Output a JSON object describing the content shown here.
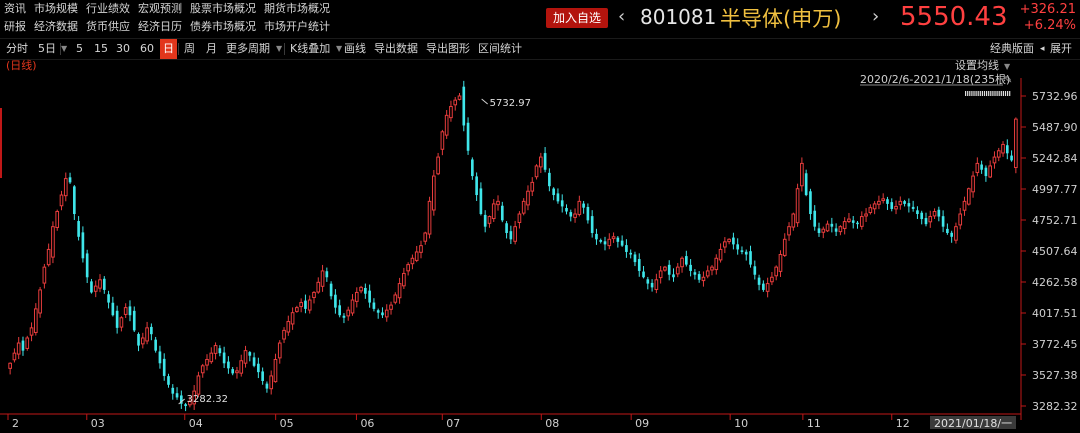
{
  "nav": {
    "row1": [
      "资讯",
      "市场规模",
      "行业绩效",
      "宏观预测",
      "股票市场概况",
      "期货市场概况"
    ],
    "row2": [
      "研报",
      "经济数据",
      "货币供应",
      "经济日历",
      "债券市场概况",
      "市场开户统计"
    ]
  },
  "quote": {
    "add_favorite": "加入自选",
    "prev_arrow": "‹",
    "next_arrow": "›",
    "code": "801081",
    "name": "半导体(申万)",
    "price": "5550.43",
    "change": "+326.21",
    "change_pct": "+6.24%"
  },
  "toolbar": {
    "items": [
      "分时",
      "5日",
      "5",
      "15",
      "30",
      "60",
      "日",
      "周",
      "月",
      "更多周期",
      "K线叠加",
      "画线",
      "导出数据",
      "导出图形",
      "区间统计"
    ],
    "active": "日",
    "right_items": [
      "经典版面",
      "展开"
    ]
  },
  "chart_overlay": {
    "daily_label": "(日线)",
    "ma_setting": "设置均线",
    "range_text": "2020/2/6-2021/1/18(235根)",
    "cursor_date": "2021/01/18/一"
  },
  "chart_data": {
    "type": "candlestick",
    "title": "",
    "period": "日线",
    "ylim": [
      3200,
      5800
    ],
    "y_ticks": [
      "5732.96",
      "5487.90",
      "5242.84",
      "4997.77",
      "4752.71",
      "4507.64",
      "4262.58",
      "4017.51",
      "3772.45",
      "3527.38",
      "3282.32"
    ],
    "x_ticks": [
      {
        "label": "2",
        "t": 0.0
      },
      {
        "label": "03",
        "t": 0.078
      },
      {
        "label": "04",
        "t": 0.175
      },
      {
        "label": "05",
        "t": 0.265
      },
      {
        "label": "06",
        "t": 0.345
      },
      {
        "label": "07",
        "t": 0.43
      },
      {
        "label": "08",
        "t": 0.528
      },
      {
        "label": "09",
        "t": 0.617
      },
      {
        "label": "10",
        "t": 0.715
      },
      {
        "label": "11",
        "t": 0.787
      },
      {
        "label": "12",
        "t": 0.875
      }
    ],
    "annotations": [
      {
        "label": "5732.97",
        "type": "high",
        "t": 0.465,
        "value": 5732.97
      },
      {
        "label": "3282.32",
        "type": "low",
        "t": 0.165,
        "value": 3282.32
      }
    ],
    "closes": [
      3620,
      3700,
      3780,
      3720,
      3820,
      3900,
      4050,
      4200,
      4380,
      4520,
      4700,
      4820,
      4950,
      5080,
      5050,
      4800,
      4620,
      4450,
      4300,
      4180,
      4230,
      4280,
      4200,
      4100,
      4000,
      3900,
      3980,
      4060,
      4000,
      3880,
      3760,
      3820,
      3900,
      3850,
      3720,
      3620,
      3520,
      3450,
      3380,
      3350,
      3300,
      3282,
      3320,
      3400,
      3520,
      3600,
      3650,
      3700,
      3760,
      3700,
      3620,
      3580,
      3540,
      3560,
      3640,
      3720,
      3680,
      3600,
      3550,
      3480,
      3420,
      3520,
      3650,
      3780,
      3880,
      3950,
      4020,
      4060,
      4100,
      4050,
      4120,
      4180,
      4260,
      4350,
      4300,
      4150,
      4060,
      4000,
      3980,
      4040,
      4120,
      4180,
      4220,
      4170,
      4100,
      4050,
      4020,
      4000,
      4040,
      4080,
      4160,
      4250,
      4330,
      4400,
      4450,
      4500,
      4550,
      4650,
      4900,
      5100,
      5250,
      5450,
      5580,
      5650,
      5700,
      5733,
      5500,
      5300,
      5100,
      4950,
      4800,
      4700,
      4780,
      4880,
      4900,
      4750,
      4650,
      4600,
      4700,
      4800,
      4900,
      4980,
      5050,
      5180,
      5250,
      5150,
      5020,
      4950,
      4900,
      4860,
      4820,
      4780,
      4800,
      4900,
      4850,
      4750,
      4650,
      4600,
      4580,
      4560,
      4600,
      4620,
      4580,
      4550,
      4500,
      4480,
      4420,
      4350,
      4300,
      4250,
      4220,
      4280,
      4350,
      4380,
      4320,
      4300,
      4380,
      4450,
      4400,
      4350,
      4320,
      4280,
      4300,
      4350,
      4380,
      4450,
      4520,
      4580,
      4600,
      4560,
      4520,
      4500,
      4480,
      4400,
      4320,
      4240,
      4200,
      4250,
      4300,
      4380,
      4480,
      4600,
      4700,
      4800,
      5000,
      5200,
      4950,
      4800,
      4700,
      4650,
      4680,
      4720,
      4700,
      4660,
      4700,
      4740,
      4760,
      4730,
      4720,
      4780,
      4800,
      4850,
      4880,
      4900,
      4920,
      4880,
      4840,
      4860,
      4900,
      4880,
      4860,
      4840,
      4800,
      4760,
      4720,
      4780,
      4820,
      4780,
      4700,
      4650,
      4620,
      4700,
      4800,
      4900,
      5000,
      5100,
      5200,
      5150,
      5100,
      5180,
      5250,
      5300,
      5350,
      5280,
      5224,
      5550
    ],
    "up_color": "#e63c3c",
    "down_color": "#3fe6ea",
    "grid": false
  }
}
